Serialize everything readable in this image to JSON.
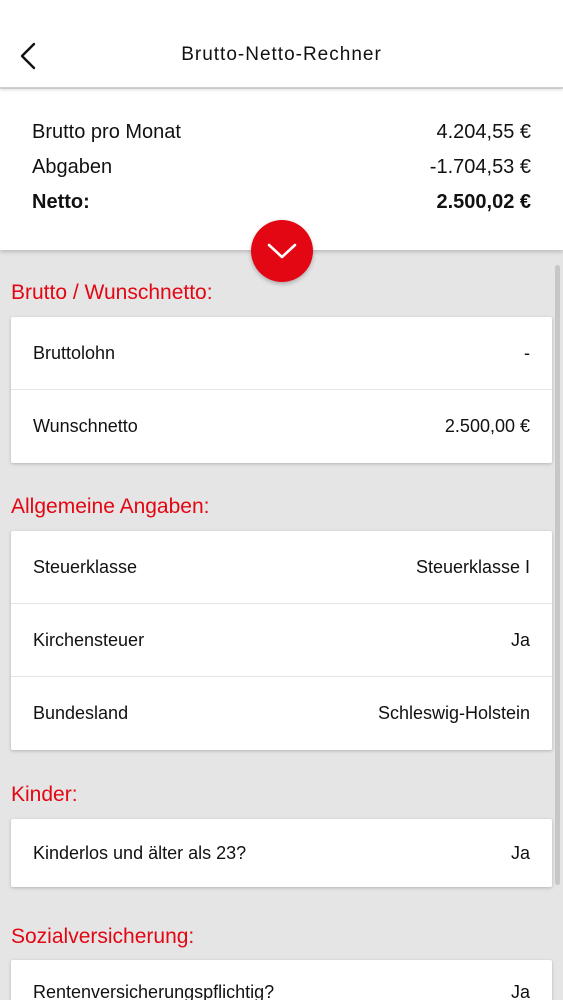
{
  "header": {
    "title": "Brutto-Netto-Rechner"
  },
  "summary": {
    "brutto_label": "Brutto pro Monat",
    "brutto_value": "4.204,55 €",
    "abgaben_label": "Abgaben",
    "abgaben_value": "-1.704,53 €",
    "netto_label": "Netto:",
    "netto_value": "2.500,02 €"
  },
  "sections": {
    "brutto": {
      "title": "Brutto / Wunschnetto:",
      "rows": [
        {
          "label": "Bruttolohn",
          "value": "-"
        },
        {
          "label": "Wunschnetto",
          "value": "2.500,00 €"
        }
      ]
    },
    "allgemein": {
      "title": "Allgemeine Angaben:",
      "rows": [
        {
          "label": "Steuerklasse",
          "value": "Steuerklasse I"
        },
        {
          "label": "Kirchensteuer",
          "value": "Ja"
        },
        {
          "label": "Bundesland",
          "value": "Schleswig-Holstein"
        }
      ]
    },
    "kinder": {
      "title": "Kinder:",
      "rows": [
        {
          "label": "Kinderlos und älter als 23?",
          "value": "Ja"
        }
      ]
    },
    "sozial": {
      "title": "Sozialversicherung:",
      "rows": [
        {
          "label": "Rentenversicherungspflichtig?",
          "value": "Ja"
        }
      ]
    }
  },
  "icons": {
    "back": "back-arrow-icon",
    "toggle": "chevron-down-icon"
  },
  "colors": {
    "accent": "#e30613",
    "background": "#e5e5e5",
    "card": "#ffffff"
  }
}
